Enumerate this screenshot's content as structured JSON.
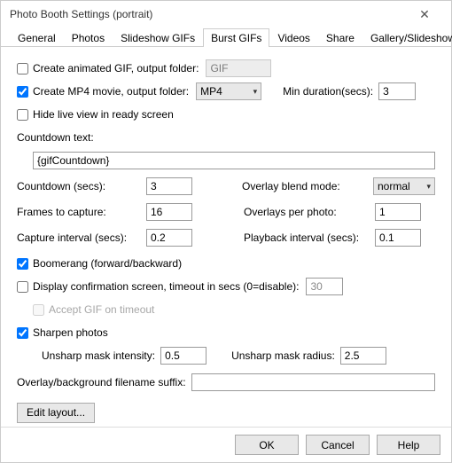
{
  "window": {
    "title": "Photo Booth Settings (portrait)"
  },
  "tabs": {
    "general": "General",
    "photos": "Photos",
    "slideshow": "Slideshow GIFs",
    "burst": "Burst GIFs",
    "videos": "Videos",
    "share": "Share",
    "gallery": "Gallery/Slideshow"
  },
  "opt": {
    "create_gif_label": "Create animated GIF, output folder:",
    "create_gif_folder": "GIF",
    "create_mp4_label": "Create MP4 movie, output folder:",
    "create_mp4_folder": "MP4",
    "min_duration_label": "Min duration(secs):",
    "min_duration": "3",
    "hide_live_label": "Hide live view in ready screen",
    "countdown_text_label": "Countdown text:",
    "countdown_text": "{gifCountdown}",
    "countdown_secs_label": "Countdown (secs):",
    "countdown_secs": "3",
    "overlay_blend_label": "Overlay blend mode:",
    "overlay_blend": "normal",
    "frames_label": "Frames to capture:",
    "frames": "16",
    "overlays_per_label": "Overlays per photo:",
    "overlays_per": "1",
    "capture_interval_label": "Capture interval (secs):",
    "capture_interval": "0.2",
    "playback_interval_label": "Playback interval (secs):",
    "playback_interval": "0.1",
    "boomerang_label": "Boomerang (forward/backward)",
    "confirm_label": "Display confirmation screen, timeout in secs (0=disable):",
    "confirm_timeout": "30",
    "accept_gif_label": "Accept GIF on timeout",
    "sharpen_label": "Sharpen photos",
    "unsharp_intensity_label": "Unsharp mask intensity:",
    "unsharp_intensity": "0.5",
    "unsharp_radius_label": "Unsharp mask radius:",
    "unsharp_radius": "2.5",
    "suffix_label": "Overlay/background filename suffix:",
    "suffix": "",
    "edit_layout_btn": "Edit layout..."
  },
  "footer": {
    "ok": "OK",
    "cancel": "Cancel",
    "help": "Help"
  }
}
